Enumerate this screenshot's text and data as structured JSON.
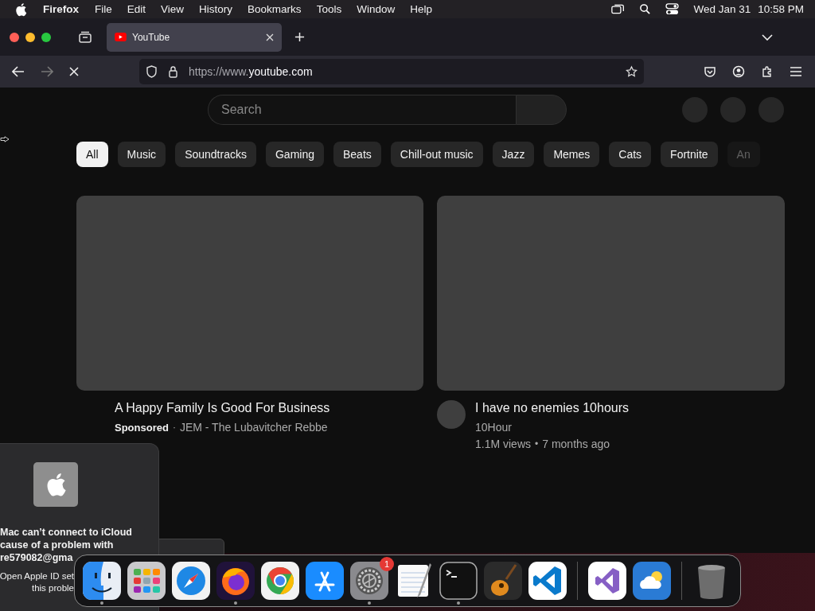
{
  "menubar": {
    "app": "Firefox",
    "menus": [
      "File",
      "Edit",
      "View",
      "History",
      "Bookmarks",
      "Tools",
      "Window",
      "Help"
    ],
    "date": "Wed Jan 31",
    "time": "10:58 PM"
  },
  "tabs": [
    {
      "title": "YouTube",
      "selected": true
    }
  ],
  "address": {
    "prefix": "https://www.",
    "domain": "youtube.com"
  },
  "search": {
    "placeholder": "Search"
  },
  "chips": [
    {
      "label": "All",
      "selected": true
    },
    {
      "label": "Music",
      "selected": false
    },
    {
      "label": "Soundtracks",
      "selected": false
    },
    {
      "label": "Gaming",
      "selected": false
    },
    {
      "label": "Beats",
      "selected": false
    },
    {
      "label": "Chill-out music",
      "selected": false
    },
    {
      "label": "Jazz",
      "selected": false
    },
    {
      "label": "Memes",
      "selected": false
    },
    {
      "label": "Cats",
      "selected": false
    },
    {
      "label": "Fortnite",
      "selected": false
    },
    {
      "label": "An",
      "selected": false
    }
  ],
  "videos": [
    {
      "kind": "ad",
      "title": "A Happy Family Is Good For Business",
      "badge": "Sponsored",
      "separator": "·",
      "channel": "JEM - The Lubavitcher Rebbe"
    },
    {
      "kind": "video",
      "title": "I have no enemies 10hours",
      "channel": "10Hour",
      "views": "1.1M views",
      "separator": "•",
      "age": "7 months ago"
    }
  ],
  "notification": {
    "lines": [
      "Mac can’t connect to iCloud",
      "cause of a problem with",
      "re579082@gma"
    ],
    "body_lines": [
      "Open Apple ID set",
      "this proble"
    ]
  },
  "dock": [
    {
      "kind": "finder",
      "running": true
    },
    {
      "kind": "launchpad",
      "running": false
    },
    {
      "kind": "safari",
      "running": false
    },
    {
      "kind": "firefox",
      "running": true
    },
    {
      "kind": "chrome",
      "running": false
    },
    {
      "kind": "appstore",
      "running": false
    },
    {
      "kind": "settings",
      "running": true,
      "badge": "1"
    },
    {
      "kind": "textedit",
      "running": false
    },
    {
      "kind": "terminal",
      "running": true
    },
    {
      "kind": "guitar",
      "running": false
    },
    {
      "kind": "vscode",
      "running": false
    },
    {
      "kind": "separator"
    },
    {
      "kind": "visualstudio",
      "running": false
    },
    {
      "kind": "weather",
      "running": false
    },
    {
      "kind": "separator"
    },
    {
      "kind": "trash",
      "running": false
    }
  ]
}
